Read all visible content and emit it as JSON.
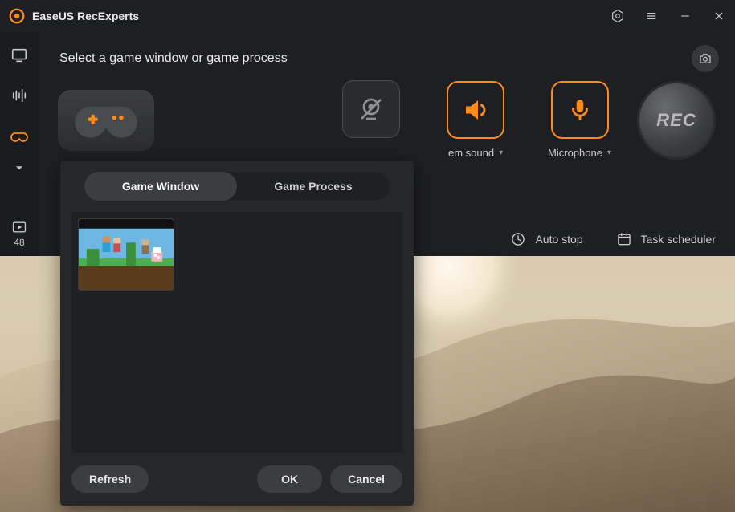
{
  "app": {
    "title": "EaseUS RecExperts"
  },
  "colors": {
    "accent": "#ff8c1a"
  },
  "sidebar": {
    "icons": [
      "screen",
      "audio",
      "game",
      "more"
    ],
    "recordings_count": "48"
  },
  "main": {
    "heading": "Select a game window or game process",
    "system_sound_label": "em sound",
    "microphone_label": "Microphone",
    "rec_label": "REC"
  },
  "footer": {
    "auto_stop_label": "Auto stop",
    "task_scheduler_label": "Task scheduler"
  },
  "popup": {
    "tabs": {
      "game_window": "Game Window",
      "game_process": "Game Process"
    },
    "buttons": {
      "refresh": "Refresh",
      "ok": "OK",
      "cancel": "Cancel"
    },
    "thumbs": [
      {
        "name": "minecraft-window"
      }
    ]
  }
}
